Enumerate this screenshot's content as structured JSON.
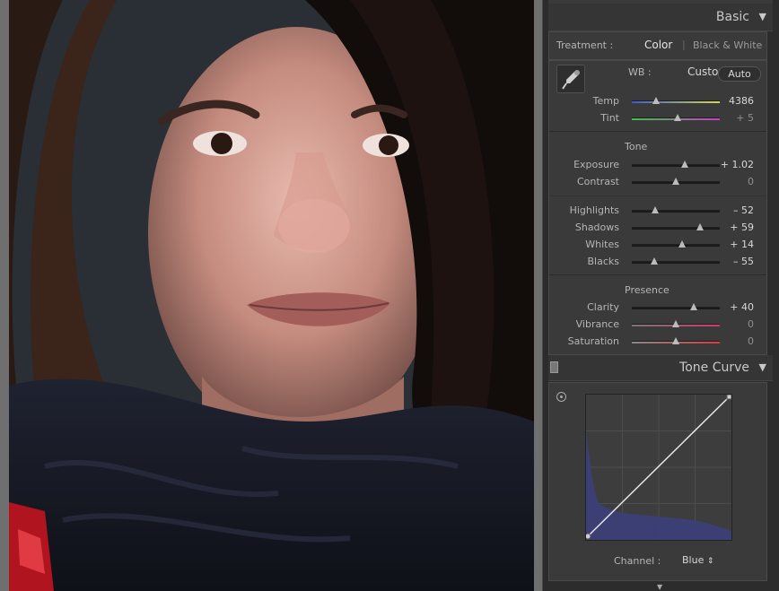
{
  "basic": {
    "title": "Basic",
    "treatment_label": "Treatment :",
    "treatment_color": "Color",
    "treatment_sep": "|",
    "treatment_bw": "Black & White",
    "wb_label": "WB :",
    "wb_value": "Custom",
    "temp": {
      "label": "Temp",
      "value": "4386",
      "pos": 0.28
    },
    "tint": {
      "label": "Tint",
      "value": "+ 5",
      "pos": 0.52
    },
    "tone_label": "Tone",
    "auto_label": "Auto",
    "exposure": {
      "label": "Exposure",
      "value": "+ 1.02",
      "pos": 0.6
    },
    "contrast": {
      "label": "Contrast",
      "value": "0",
      "pos": 0.5
    },
    "highlights": {
      "label": "Highlights",
      "value": "– 52",
      "pos": 0.27
    },
    "shadows": {
      "label": "Shadows",
      "value": "+ 59",
      "pos": 0.78
    },
    "whites": {
      "label": "Whites",
      "value": "+ 14",
      "pos": 0.57
    },
    "blacks": {
      "label": "Blacks",
      "value": "– 55",
      "pos": 0.26
    },
    "presence_label": "Presence",
    "clarity": {
      "label": "Clarity",
      "value": "+ 40",
      "pos": 0.7
    },
    "vibrance": {
      "label": "Vibrance",
      "value": "0",
      "pos": 0.5
    },
    "saturation": {
      "label": "Saturation",
      "value": "0",
      "pos": 0.5
    }
  },
  "tone_curve": {
    "title": "Tone Curve",
    "channel_label": "Channel :",
    "channel_value": "Blue"
  },
  "icons": {
    "collapse": "triangle-down-icon",
    "eyedropper": "eyedropper-icon",
    "target": "target-adjust-icon",
    "stepper": "updown-stepper-icon"
  },
  "colors": {
    "panel_bg": "#2c2c2c",
    "box_bg": "#3a3a3a",
    "active_text": "#e6e6e6",
    "histogram": "#3b3f7a"
  }
}
